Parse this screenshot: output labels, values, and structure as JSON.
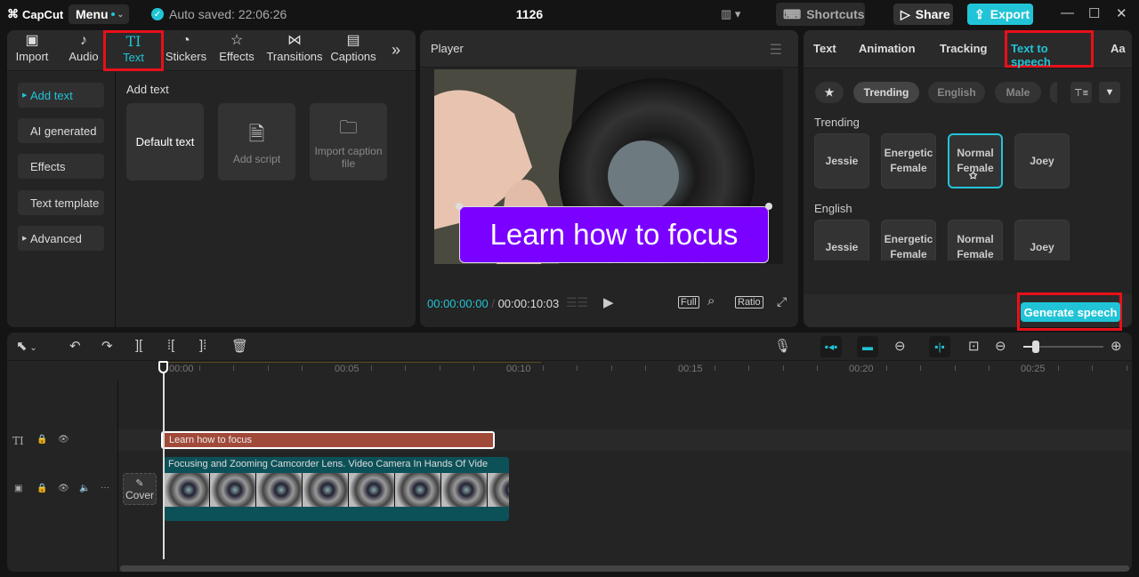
{
  "titlebar": {
    "app_name": "CapCut",
    "menu_label": "Menu",
    "autosave_text": "Auto saved: 22:06:26",
    "project_title": "1126",
    "shortcuts_label": "Shortcuts",
    "share_label": "Share",
    "export_label": "Export",
    "accent_color": "#21c4d6"
  },
  "media_tabs": [
    {
      "label": "Import",
      "icon": "import-icon"
    },
    {
      "label": "Audio",
      "icon": "audio-icon"
    },
    {
      "label": "Text",
      "icon": "text-icon",
      "active": true
    },
    {
      "label": "Stickers",
      "icon": "stickers-icon"
    },
    {
      "label": "Effects",
      "icon": "effects-icon"
    },
    {
      "label": "Transitions",
      "icon": "transitions-icon"
    },
    {
      "label": "Captions",
      "icon": "captions-icon"
    }
  ],
  "text_sidebar": [
    {
      "label": "Add text",
      "active": true,
      "expandable": true
    },
    {
      "label": "AI generated"
    },
    {
      "label": "Effects"
    },
    {
      "label": "Text template"
    },
    {
      "label": "Advanced",
      "expandable": true
    }
  ],
  "add_text": {
    "section_title": "Add text",
    "cards": [
      {
        "label": "Default text"
      },
      {
        "label": "Add script"
      },
      {
        "label": "Import caption file"
      }
    ]
  },
  "player": {
    "title": "Player",
    "caption_text": "Learn how to focus",
    "current_time": "00:00:00:00",
    "separator": "/",
    "total_time": "00:00:10:03",
    "full_label": "Full",
    "ratio_label": "Ratio"
  },
  "right_panel": {
    "tabs": [
      "Text",
      "Animation",
      "Tracking",
      "Text to speech",
      "Aa"
    ],
    "active_tab": "Text to speech",
    "filters": [
      "Trending",
      "English",
      "Male"
    ],
    "active_filter": "Trending",
    "sections": [
      {
        "title": "Trending",
        "voices": [
          "Jessie",
          "Energetic Female",
          "Normal Female",
          "Joey"
        ],
        "selected": "Normal Female"
      },
      {
        "title": "English",
        "voices": [
          "Jessie",
          "Energetic Female",
          "Normal Female",
          "Joey"
        ]
      }
    ],
    "generate_label": "Generate speech"
  },
  "timeline": {
    "ruler_labels": [
      "00:00",
      "00:05",
      "00:10",
      "00:15",
      "00:20",
      "00:25"
    ],
    "text_clip_label": "Learn how to focus",
    "video_clip_label": "Focusing and Zooming Camcorder Lens. Video Camera In Hands Of Vide",
    "cover_label": "Cover",
    "zoom_level": 0.15
  }
}
